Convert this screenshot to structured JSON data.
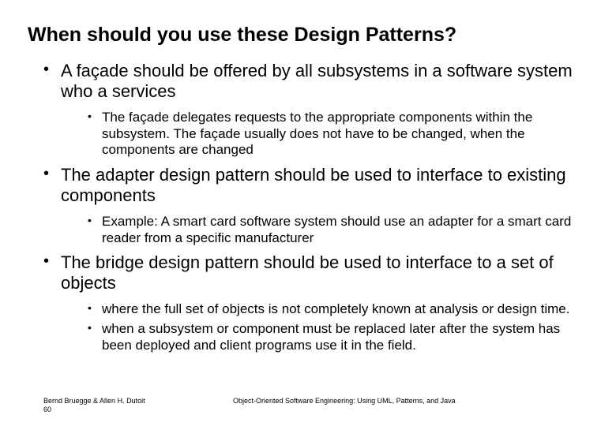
{
  "title": "When should you use these Design Patterns?",
  "bullets": [
    {
      "text": " A façade should be offered by all subsystems in a software system who a services",
      "sub": [
        "The façade delegates requests to the appropriate components within the subsystem. The façade usually does not have to be changed, when the components are changed"
      ]
    },
    {
      "text": "The adapter design pattern should be used to interface to existing components",
      "sub": [
        "Example: A smart card software system should use an adapter for a smart card reader from a specific manufacturer"
      ]
    },
    {
      "text": "The bridge design pattern should be used to interface to a set of  objects",
      "sub": [
        "where the full set of objects is not completely known at analysis or design time.",
        "when a subsystem or component must be replaced later after the system has been deployed and client programs use it in the field."
      ]
    }
  ],
  "footer": {
    "authors": "Bernd Bruegge & Allen H. Dutoit",
    "page": "60",
    "book": "Object-Oriented Software Engineering: Using UML, Patterns, and Java"
  }
}
